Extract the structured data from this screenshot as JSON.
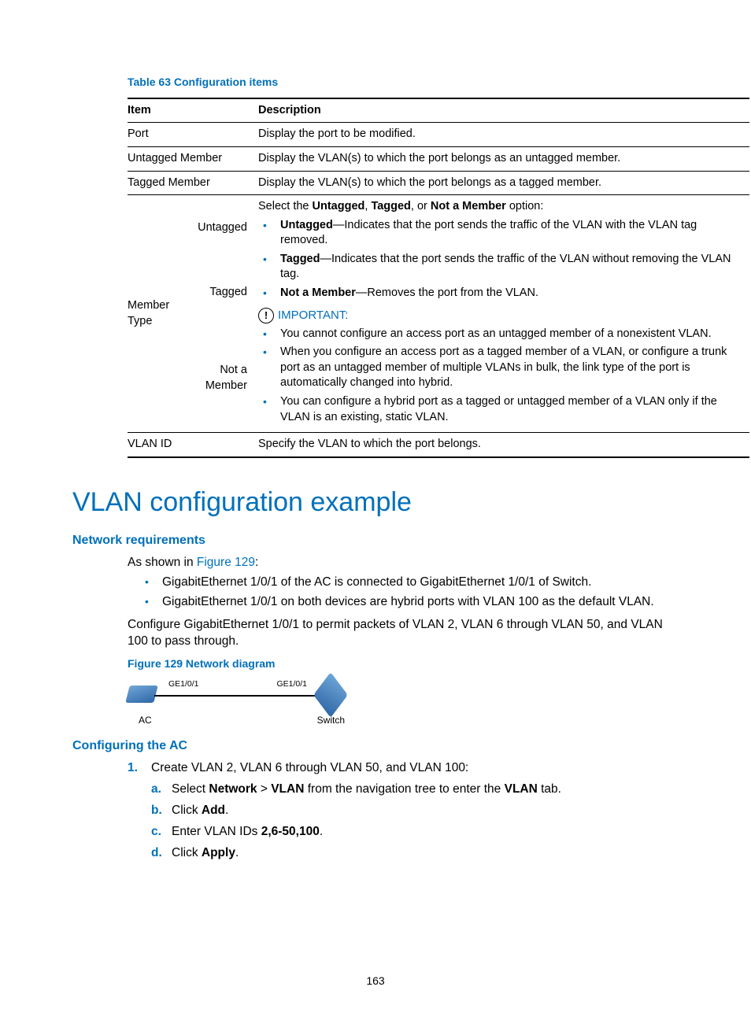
{
  "table": {
    "caption": "Table 63 Configuration items",
    "head_item": "Item",
    "head_desc": "Description",
    "rows": {
      "port_item": "Port",
      "port_desc": "Display the port to be modified.",
      "untag_item": "Untagged Member",
      "untag_desc": "Display the VLAN(s) to which the port belongs as an untagged member.",
      "tag_item": "Tagged Member",
      "tag_desc": "Display the VLAN(s) to which the port belongs as a tagged member.",
      "mt_item": "Member Type",
      "mt_sub_untag": "Untagged",
      "mt_sub_tag": "Tagged",
      "mt_sub_not": "Not a Member",
      "mt_intro_pre": "Select the ",
      "mt_intro_u": "Untagged",
      "mt_intro_sep1": ", ",
      "mt_intro_t": "Tagged",
      "mt_intro_sep2": ", or ",
      "mt_intro_n": "Not a Member",
      "mt_intro_post": " option:",
      "mt_li1_b": "Untagged",
      "mt_li1_t": "—Indicates that the port sends the traffic of the VLAN with the VLAN tag removed.",
      "mt_li2_b": "Tagged",
      "mt_li2_t": "—Indicates that the port sends the traffic of the VLAN without removing the VLAN tag.",
      "mt_li3_b": "Not a Member",
      "mt_li3_t": "—Removes the port from the VLAN.",
      "important_label": "IMPORTANT:",
      "imp1": "You cannot configure an access port as an untagged member of a nonexistent VLAN.",
      "imp2": "When you configure an access port as a tagged member of a VLAN, or configure a trunk port as an untagged member of multiple VLANs in bulk, the link type of the port is automatically changed into hybrid.",
      "imp3": "You can configure a hybrid port as a tagged or untagged member of a VLAN only if the VLAN is an existing, static VLAN.",
      "vlanid_item": "VLAN ID",
      "vlanid_desc": "Specify the VLAN to which the port belongs."
    }
  },
  "h1": "VLAN configuration example",
  "h2a": "Network requirements",
  "intro_pre": "As shown in ",
  "intro_ref": "Figure 129",
  "intro_post": ":",
  "bul1": "GigabitEthernet 1/0/1 of the AC is connected to GigabitEthernet 1/0/1 of Switch.",
  "bul2": "GigabitEthernet 1/0/1 on both devices are hybrid ports with VLAN 100 as the default VLAN.",
  "para2": "Configure GigabitEthernet 1/0/1 to permit packets of VLAN 2, VLAN 6 through VLAN 50, and VLAN 100 to pass through.",
  "fig_caption": "Figure 129 Network diagram",
  "fig_ge1": "GE1/0/1",
  "fig_ge2": "GE1/0/1",
  "fig_ac": "AC",
  "fig_sw": "Switch",
  "h2b": "Configuring the AC",
  "step1_num": "1.",
  "step1_text": "Create VLAN 2, VLAN 6 through VLAN 50, and VLAN 100:",
  "sa_m": "a.",
  "sa_pre": "Select ",
  "sa_b1": "Network",
  "sa_mid": " > ",
  "sa_b2": "VLAN",
  "sa_mid2": " from the navigation tree to enter the ",
  "sa_b3": "VLAN",
  "sa_post": " tab.",
  "sb_m": "b.",
  "sb_pre": "Click ",
  "sb_b": "Add",
  "sb_post": ".",
  "sc_m": "c.",
  "sc_pre": "Enter VLAN IDs ",
  "sc_b": "2,6-50,100",
  "sc_post": ".",
  "sd_m": "d.",
  "sd_pre": "Click ",
  "sd_b": "Apply",
  "sd_post": ".",
  "page_num": "163"
}
